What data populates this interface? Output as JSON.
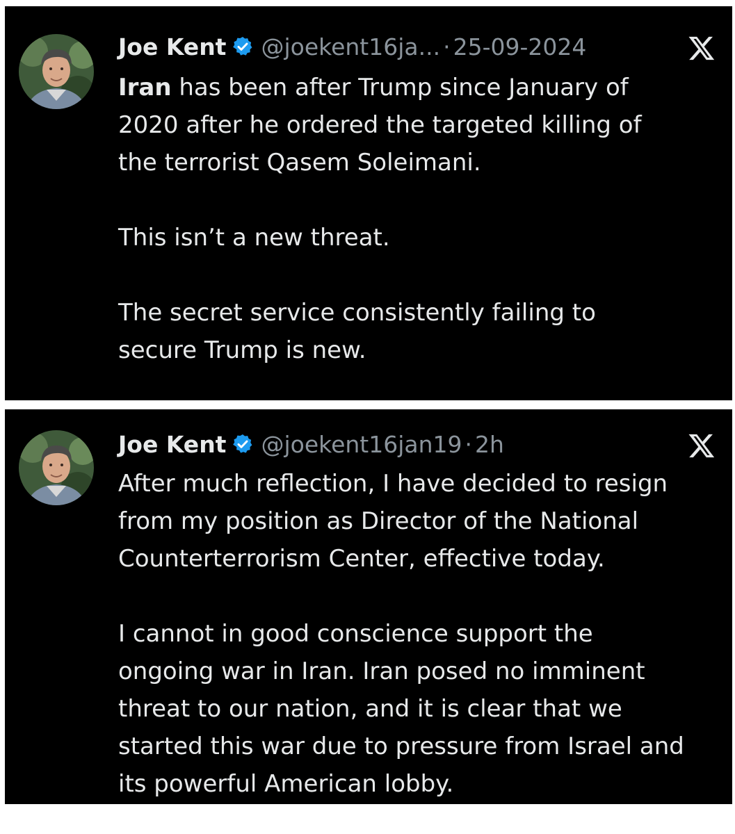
{
  "tweets": [
    {
      "author": "Joe Kent",
      "handle": "@joekent16ja...",
      "separator": "·",
      "time": "25-09-2024",
      "paragraphs": [
        {
          "lead_bold": "Iran",
          "lines": [
            " has been after Trump since January of",
            "2020 after he ordered the targeted killing of",
            "the terrorist Qasem Soleimani."
          ]
        },
        {
          "lines": [
            "This isn’t a new threat."
          ]
        },
        {
          "lines": [
            "The secret service consistently failing to",
            "secure Trump is new."
          ]
        }
      ]
    },
    {
      "author": "Joe Kent",
      "handle": "@joekent16jan19",
      "separator": "·",
      "time": "2h",
      "paragraphs": [
        {
          "lines": [
            "After much reflection, I have decided to resign",
            "from my position as Director of the National",
            "Counterterrorism Center, effective today."
          ]
        },
        {
          "lines": [
            "I cannot in good conscience support the",
            "ongoing war in Iran. Iran posed no imminent",
            "threat to our nation, and it is clear that we",
            "started this war due to pressure from Israel and",
            "its powerful American lobby."
          ]
        }
      ]
    }
  ],
  "icons": {
    "verified": "verified-badge-icon",
    "platform": "x-logo-icon"
  },
  "colors": {
    "background": "#000000",
    "text": "#e7e9ea",
    "secondary": "#8b949c",
    "verified": "#1d9bf0"
  }
}
